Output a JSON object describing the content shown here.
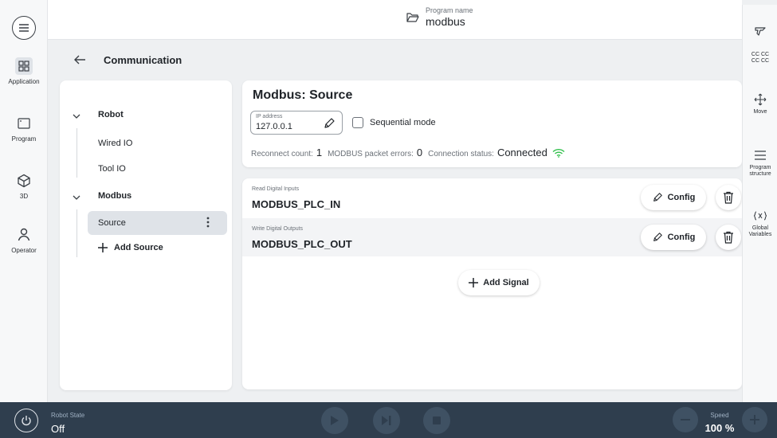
{
  "header": {
    "program_name_label": "Program name",
    "program_name": "modbus"
  },
  "left_nav": {
    "items": [
      {
        "label": "Application",
        "icon": "grid-icon",
        "active": true
      },
      {
        "label": "Program",
        "icon": "program-icon"
      },
      {
        "label": "3D",
        "icon": "cube-icon"
      },
      {
        "label": "Operator",
        "icon": "person-icon"
      }
    ]
  },
  "page": {
    "title": "Communication"
  },
  "tree": {
    "robot": "Robot",
    "wired_io": "Wired IO",
    "tool_io": "Tool IO",
    "modbus": "Modbus",
    "source": "Source",
    "add_source": "Add Source"
  },
  "source_card": {
    "title": "Modbus: Source",
    "ip_label": "IP address",
    "ip_value": "127.0.0.1",
    "sequential_mode_label": "Sequential mode",
    "reconnect_count_label": "Reconnect count:",
    "reconnect_count": "1",
    "packet_errors_label": "MODBUS packet errors:",
    "packet_errors": "0",
    "connection_status_label": "Connection status:",
    "connection_status": "Connected"
  },
  "signals": [
    {
      "category": "Read Digital Inputs",
      "name": "MODBUS_PLC_IN",
      "config_label": "Config"
    },
    {
      "category": "Write Digital Outputs",
      "name": "MODBUS_PLC_OUT",
      "config_label": "Config"
    }
  ],
  "add_signal_label": "Add Signal",
  "right_nav": {
    "items": [
      {
        "label": "",
        "icon": "gripper-icon"
      },
      {
        "label": "CC CC\nCC CC",
        "icon": ""
      },
      {
        "label": "Move",
        "icon": "move-icon"
      },
      {
        "label": "Program structure",
        "icon": "list-icon"
      },
      {
        "label": "Global Variables",
        "icon": "variables-icon"
      }
    ]
  },
  "bottom": {
    "robot_state_label": "Robot State",
    "robot_state": "Off",
    "speed_label": "Speed",
    "speed_value": "100 %"
  },
  "colors": {
    "status_green": "#2fbf4a",
    "bottom_bar": "#2f3e4e"
  }
}
